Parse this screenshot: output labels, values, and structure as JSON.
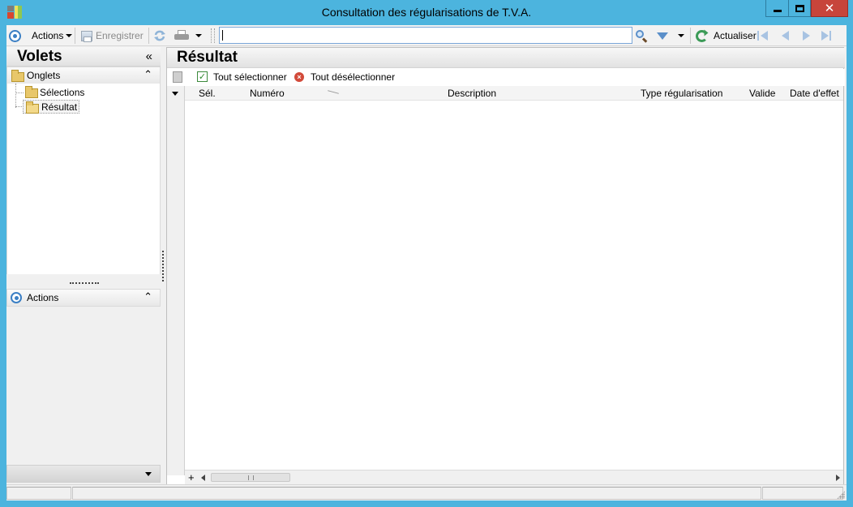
{
  "window": {
    "title": "Consultation des régularisations de  T.V.A."
  },
  "toolbar": {
    "actions_label": "Actions",
    "save_label": "Enregistrer",
    "search_value": "",
    "refresh_label": "Actualiser"
  },
  "left_pane": {
    "title": "Volets",
    "collapse_glyph": "«",
    "tabs_section": {
      "label": "Onglets",
      "items": [
        {
          "label": "Sélections"
        },
        {
          "label": "Résultat"
        }
      ]
    },
    "actions_section": {
      "label": "Actions"
    }
  },
  "result": {
    "title": "Résultat",
    "select_all_label": "Tout sélectionner",
    "deselect_all_label": "Tout désélectionner",
    "columns": [
      "Sél.",
      "Numéro",
      "Description",
      "Type régularisation",
      "Valide",
      "Date d'effet"
    ],
    "rows": []
  },
  "icons": {
    "actions": "target-ring-icon",
    "save": "save-icon",
    "refresh_sync": "sync-icon",
    "print": "printer-icon",
    "search": "magnifier-icon",
    "filter": "funnel-icon",
    "refresh": "green-refresh-icon",
    "nav": [
      "first-icon",
      "previous-icon",
      "next-icon",
      "last-icon"
    ]
  },
  "colors": {
    "window_frame": "#4cb4de",
    "close_button": "#c7453b",
    "accent": "#3b7fc4"
  }
}
